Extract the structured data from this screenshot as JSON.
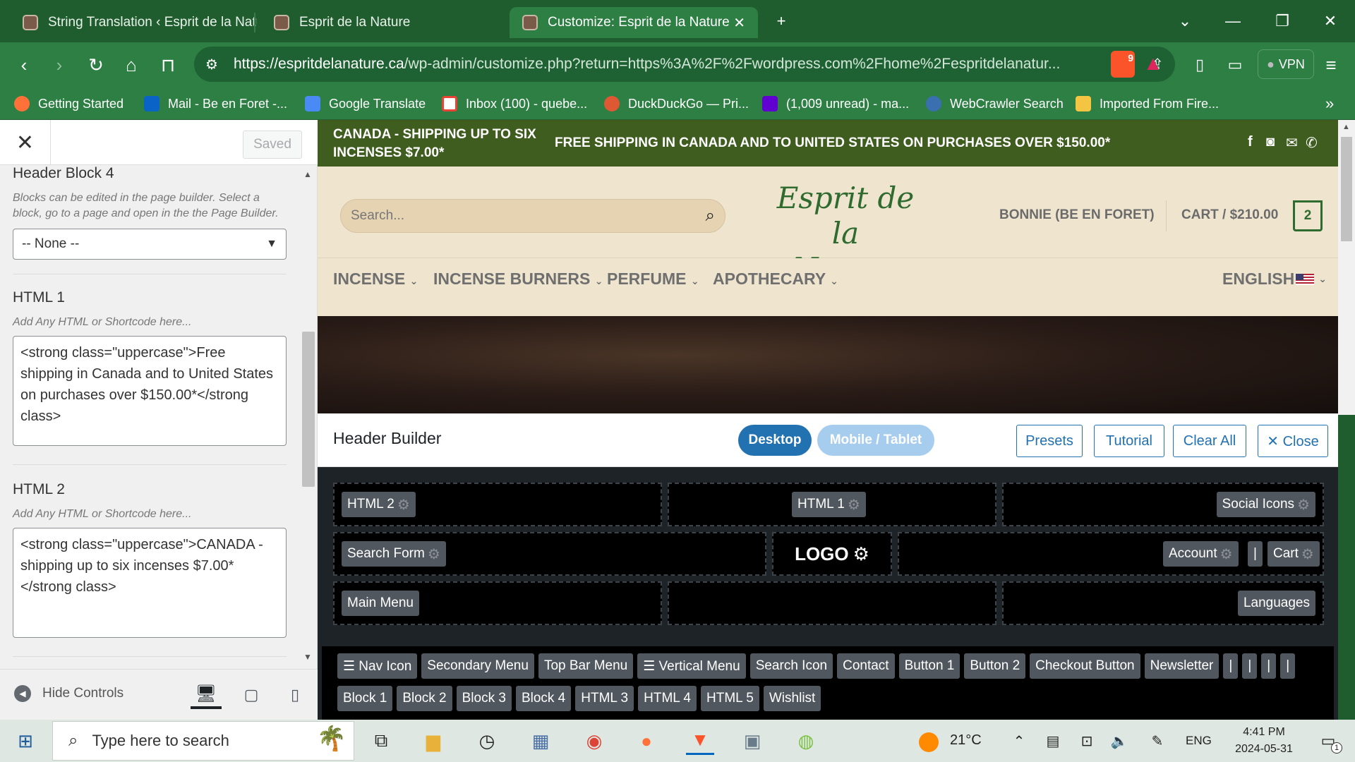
{
  "browser": {
    "tabs": [
      {
        "title": "String Translation ‹ Esprit de la Natur"
      },
      {
        "title": "Esprit de la Nature"
      },
      {
        "title": "Customize: Esprit de la Nature",
        "active": true
      }
    ],
    "new_tab": "+",
    "url_domain": "https://espritdelanature.ca",
    "url_path": "/wp-admin/customize.php?return=https%3A%2F%2Fwordpress.com%2Fhome%2Fespritdelanatur...",
    "shield_badge": "9",
    "vpn_label": "VPN",
    "bookmarks": [
      {
        "label": "Getting Started",
        "color": "#ff7139"
      },
      {
        "label": "Mail - Be en Foret -...",
        "color": "#0a64c8"
      },
      {
        "label": "Google Translate",
        "color": "#4a8af4"
      },
      {
        "label": "Inbox (100) - quebe...",
        "color": "#ea4335"
      },
      {
        "label": "DuckDuckGo — Pri...",
        "color": "#de5833"
      },
      {
        "label": "(1,009 unread) - ma...",
        "color": "#6001d2"
      },
      {
        "label": "WebCrawler Search",
        "color": "#3a6fb0"
      },
      {
        "label": "Imported From Fire...",
        "color": "#f4c542"
      }
    ],
    "more_bookmarks": "»"
  },
  "sidebar": {
    "saved_label": "Saved",
    "header_block_title": "Header Block 4",
    "header_block_desc": "Blocks can be edited in the page builder. Select a block, go to a page and open in the the Page Builder.",
    "header_block_select": "-- None --",
    "html1_title": "HTML 1",
    "html1_placeholder": "Add Any HTML or Shortcode here...",
    "html1_value": "<strong class=\"uppercase\">Free shipping in Canada and to United States on purchases over $150.00*</strong class>",
    "html2_title": "HTML 2",
    "html2_placeholder": "Add Any HTML or Shortcode here...",
    "html2_value": "<strong class=\"uppercase\">CANADA - shipping up to six incenses $7.00*</strong class>",
    "hide_controls": "Hide Controls"
  },
  "preview": {
    "topbar_left": "CANADA - SHIPPING UP TO SIX INCENSES $7.00*",
    "topbar_center": "FREE SHIPPING IN CANADA AND TO UNITED STATES ON PURCHASES OVER $150.00*",
    "search_placeholder": "Search...",
    "logo_line1": "Esprit de",
    "logo_line2": "la Nature",
    "account": "BONNIE (BE EN FORET)",
    "cart": "CART / $210.00",
    "cart_count": "2",
    "menu": [
      "INCENSE",
      "INCENSE BURNERS",
      "PERFUME",
      "APOTHECARY"
    ],
    "language": "ENGLISH"
  },
  "header_builder": {
    "title": "Header Builder",
    "desktop": "Desktop",
    "mobile": "Mobile / Tablet",
    "presets": "Presets",
    "tutorial": "Tutorial",
    "clear_all": "Clear All",
    "close": "✕ Close",
    "row1": {
      "left": "HTML 2",
      "center": "HTML 1",
      "right": "Social Icons"
    },
    "row2": {
      "left": "Search Form",
      "logo": "LOGO",
      "account": "Account",
      "divider": "|",
      "cart": "Cart"
    },
    "row3": {
      "left": "Main Menu",
      "right": "Languages"
    },
    "available": [
      "☰ Nav Icon",
      "Secondary Menu",
      "Top Bar Menu",
      "☰ Vertical Menu",
      "Search Icon",
      "Contact",
      "Button 1",
      "Button 2",
      "Checkout Button",
      "Newsletter",
      "|",
      "|",
      "|",
      "|"
    ],
    "available2": [
      "Block 1",
      "Block 2",
      "Block 3",
      "Block 4",
      "HTML 3",
      "HTML 4",
      "HTML 5",
      "Wishlist"
    ]
  },
  "taskbar": {
    "search_placeholder": "Type here to search",
    "weather": "21°C",
    "language": "ENG",
    "time": "4:41 PM",
    "date": "2024-05-31",
    "notification_count": "1"
  }
}
